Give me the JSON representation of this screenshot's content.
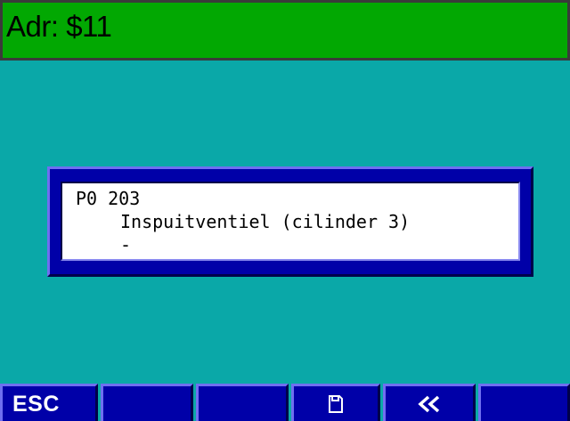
{
  "header": {
    "title": "Adr: $11"
  },
  "dialog": {
    "lines": [
      "P0 203",
      "Inspuitventiel (cilinder 3)",
      "-"
    ]
  },
  "footer": {
    "buttons": [
      {
        "label": "ESC"
      },
      {
        "label": ""
      },
      {
        "label": ""
      },
      {
        "icon": "save-icon"
      },
      {
        "icon": "rewind-icon"
      },
      {
        "label": ""
      }
    ]
  },
  "colors": {
    "background": "#0aa8a8",
    "header_bg": "#02a802",
    "panel_blue": "#0000a8",
    "text_white": "#ffffff"
  }
}
